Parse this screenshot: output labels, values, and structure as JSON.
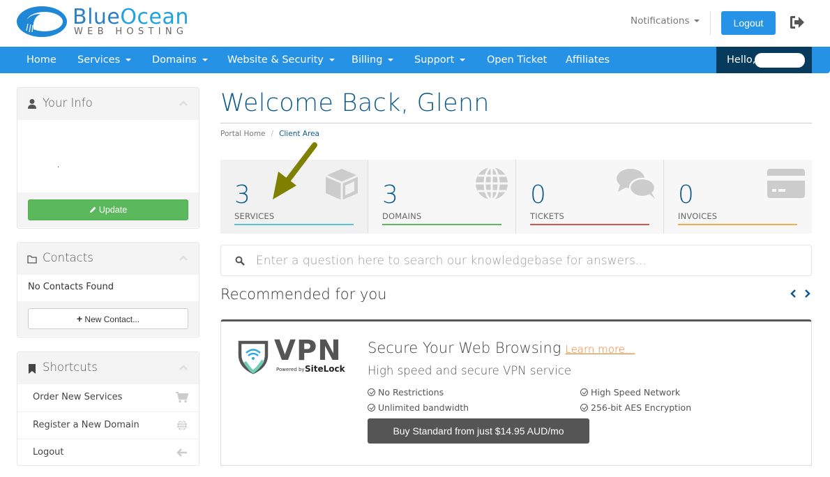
{
  "header": {
    "logo": {
      "brand_primary": "Blue",
      "brand_secondary": "Ocean",
      "tagline": "WEB HOSTING"
    },
    "notifications_label": "Notifications",
    "logout_button": "Logout",
    "logout_icon": "sign-out-icon"
  },
  "nav": {
    "items": [
      {
        "label": "Home",
        "dropdown": false
      },
      {
        "label": "Services",
        "dropdown": true
      },
      {
        "label": "Domains",
        "dropdown": true
      },
      {
        "label": "Website & Security",
        "dropdown": true
      },
      {
        "label": "Billing",
        "dropdown": true
      },
      {
        "label": "Support",
        "dropdown": true
      },
      {
        "label": "Open Ticket",
        "dropdown": false
      },
      {
        "label": "Affiliates",
        "dropdown": false
      }
    ],
    "greeting": "Hello,"
  },
  "sidebar": {
    "your_info": {
      "title": "Your Info",
      "icon": "user-icon",
      "body_text": ".",
      "update_button": "Update"
    },
    "contacts": {
      "title": "Contacts",
      "icon": "folder-icon",
      "empty_text": "No Contacts Found",
      "new_button": "New Contact..."
    },
    "shortcuts": {
      "title": "Shortcuts",
      "icon": "bookmark-icon",
      "items": [
        {
          "label": "Order New Services",
          "icon": "cart-icon"
        },
        {
          "label": "Register a New Domain",
          "icon": "globe-icon"
        },
        {
          "label": "Logout",
          "icon": "arrow-left-icon"
        }
      ]
    }
  },
  "main": {
    "title": "Welcome Back, Glenn",
    "breadcrumb": [
      "Portal Home",
      "Client Area"
    ],
    "tiles": [
      {
        "count": "3",
        "label": "SERVICES",
        "icon": "cube-icon",
        "color": "#5bc0de"
      },
      {
        "count": "3",
        "label": "DOMAINS",
        "icon": "globe-icon",
        "color": "#5cb85c"
      },
      {
        "count": "0",
        "label": "TICKETS",
        "icon": "comments-icon",
        "color": "#d9534f"
      },
      {
        "count": "0",
        "label": "INVOICES",
        "icon": "credit-card-icon",
        "color": "#f0ad4e"
      }
    ],
    "kb_search": {
      "placeholder": "Enter a question here to search our knowledgebase for answers..."
    },
    "recommended": {
      "title": "Recommended for you",
      "product": {
        "logo_text": "VPN",
        "logo_powered": "Powered by",
        "logo_brand": "SiteLock",
        "heading": "Secure Your Web Browsing",
        "learn_more": "Learn more...",
        "subheading": "High speed and secure VPN service",
        "features": [
          "No Restrictions",
          "High Speed Network",
          "Unlimited bandwidth",
          "256-bit AES Encryption"
        ],
        "buy_button": "Buy Standard from just $14.95 AUD/mo"
      }
    }
  },
  "colors": {
    "brand_blue": "#2592e6",
    "dark_navy": "#073b5d",
    "title_blue": "#0e5b8b",
    "success_green": "#5cb85c",
    "accent_orange": "#f47b20",
    "annotation_arrow": "#808000"
  }
}
